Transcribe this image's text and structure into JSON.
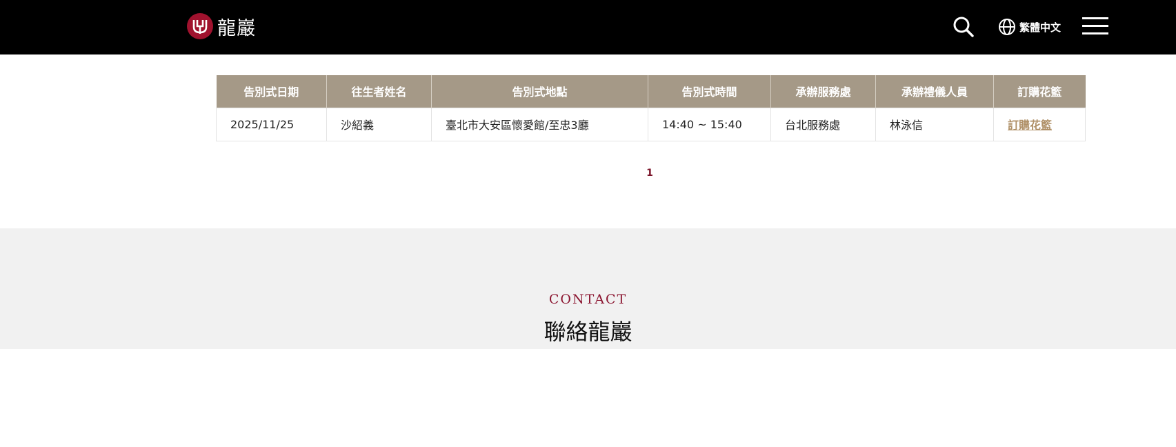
{
  "header": {
    "logo_text": "龍巖",
    "language_label": "繁體中文",
    "icons": {
      "search": "search-icon",
      "language": "globe-icon",
      "menu": "hamburger-menu-icon"
    }
  },
  "table": {
    "headers": [
      "告別式日期",
      "往生者姓名",
      "告別式地點",
      "告別式時間",
      "承辦服務處",
      "承辦禮儀人員",
      "訂購花籃"
    ],
    "rows": [
      {
        "date": "2025/11/25",
        "name": "沙紹義",
        "location": "臺北市大安區懷愛館/至忠3廳",
        "time": "14:40 ~ 15:40",
        "office": "台北服務處",
        "staff": "林泳信",
        "order_link": "訂購花籃"
      }
    ]
  },
  "pagination": {
    "current": "1"
  },
  "contact": {
    "subtitle": "CONTACT",
    "title": "聯絡龍巖"
  },
  "colors": {
    "header_bg": "#000000",
    "brand_red": "#a0122e",
    "table_header_bg": "#a59987",
    "link": "#b09169",
    "contact_bg": "#f1f1f1"
  }
}
